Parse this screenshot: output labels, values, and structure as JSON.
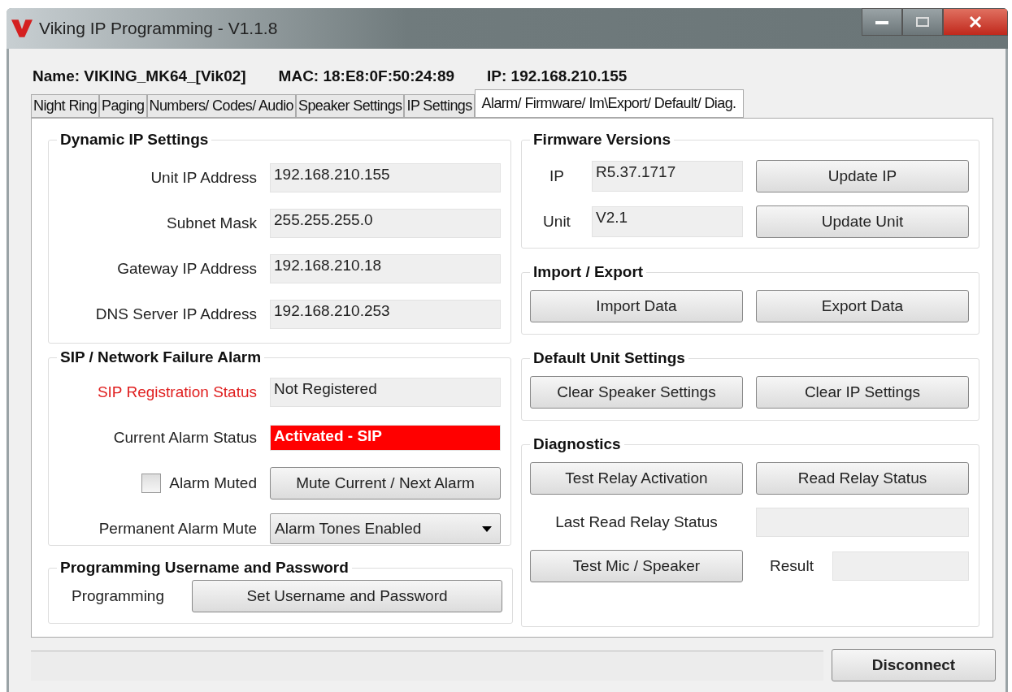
{
  "window": {
    "title": "Viking IP Programming - V1.1.8"
  },
  "header": {
    "name": "Name: VIKING_MK64_[Vik02]",
    "mac": "MAC: 18:E8:0F:50:24:89",
    "ip": "IP: 192.168.210.155"
  },
  "tabs": [
    {
      "label": "Night Ring",
      "selected": false
    },
    {
      "label": "Paging",
      "selected": false
    },
    {
      "label": "Numbers/ Codes/ Audio",
      "selected": false
    },
    {
      "label": "Speaker Settings",
      "selected": false
    },
    {
      "label": "IP Settings",
      "selected": false
    },
    {
      "label": "Alarm/ Firmware/ Im\\Export/ Default/ Diag.",
      "selected": true
    }
  ],
  "dynamic_ip": {
    "title": "Dynamic IP Settings",
    "rows": [
      {
        "label": "Unit IP Address",
        "value": "192.168.210.155"
      },
      {
        "label": "Subnet Mask",
        "value": "255.255.255.0"
      },
      {
        "label": "Gateway IP Address",
        "value": "192.168.210.18"
      },
      {
        "label": "DNS Server IP Address",
        "value": "192.168.210.253"
      }
    ]
  },
  "sip_alarm": {
    "title": "SIP / Network Failure Alarm",
    "registration": {
      "label": "SIP Registration Status",
      "value": "Not Registered",
      "error": true
    },
    "alarm_status": {
      "label": "Current Alarm Status",
      "value": "Activated - SIP",
      "active": true
    },
    "alarm_muted": {
      "label": "Alarm Muted",
      "checked": false,
      "button": "Mute Current / Next Alarm"
    },
    "permanent_mute": {
      "label": "Permanent Alarm Mute",
      "value": "Alarm Tones Enabled"
    }
  },
  "credentials": {
    "title": "Programming Username and Password",
    "label": "Programming",
    "button": "Set Username and Password"
  },
  "firmware": {
    "title": "Firmware Versions",
    "rows": [
      {
        "label": "IP",
        "value": "R5.37.1717",
        "button": "Update IP"
      },
      {
        "label": "Unit",
        "value": "V2.1",
        "button": "Update Unit"
      }
    ]
  },
  "import_export": {
    "title": "Import / Export",
    "buttons": [
      "Import Data",
      "Export Data"
    ]
  },
  "defaults": {
    "title": "Default Unit Settings",
    "buttons": [
      "Clear Speaker Settings",
      "Clear IP Settings"
    ]
  },
  "diagnostics": {
    "title": "Diagnostics",
    "buttons": [
      "Test Relay Activation",
      "Read Relay Status"
    ],
    "last_read_label": "Last Read Relay Status",
    "test_button": "Test Mic / Speaker",
    "result_label": "Result"
  },
  "footer": {
    "button": "Disconnect"
  }
}
